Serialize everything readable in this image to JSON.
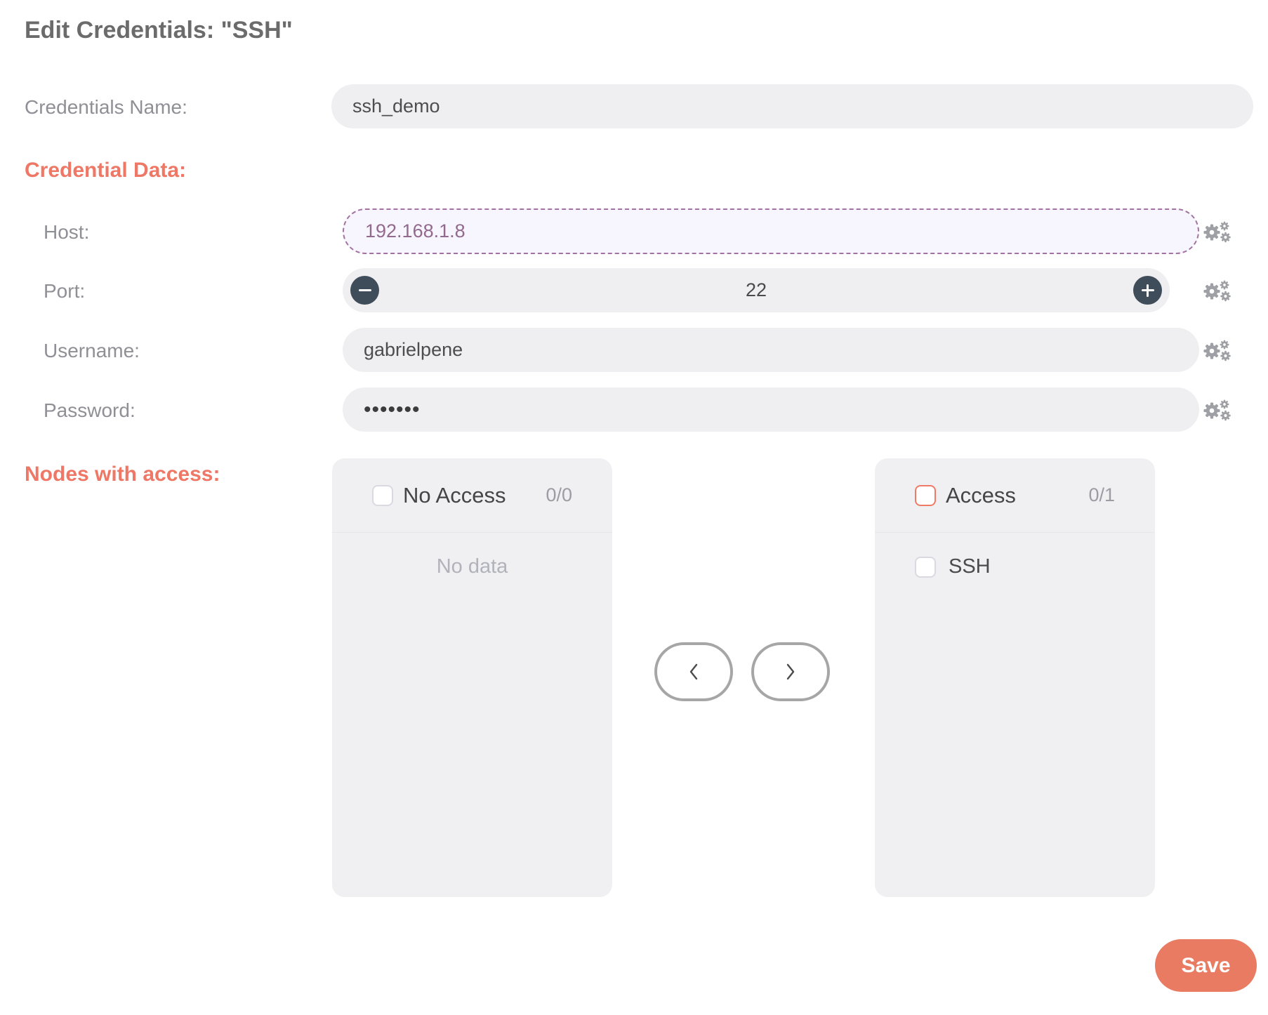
{
  "title": "Edit Credentials: \"SSH\"",
  "credentials_name": {
    "label": "Credentials Name:",
    "value": "ssh_demo"
  },
  "credential_data": {
    "heading": "Credential Data:",
    "host": {
      "label": "Host:",
      "value": "192.168.1.8"
    },
    "port": {
      "label": "Port:",
      "value": "22"
    },
    "username": {
      "label": "Username:",
      "value": "gabrielpene"
    },
    "password": {
      "label": "Password:",
      "value": "•••••••"
    }
  },
  "nodes_with_access": {
    "heading": "Nodes with access:",
    "no_access_panel": {
      "title": "No Access",
      "count": "0/0",
      "empty_text": "No data"
    },
    "access_panel": {
      "title": "Access",
      "count": "0/1",
      "items": [
        "SSH"
      ]
    }
  },
  "save_label": "Save",
  "colors": {
    "accent_heading": "#ee7765",
    "save_button": "#e97b62",
    "host_field_border": "#a472a0",
    "host_field_background": "#f7f5fd",
    "host_field_text": "#926a8e",
    "stepper_button": "#3f4c59",
    "field_background": "#efeff1",
    "panel_background": "#f0f0f2",
    "access_checkbox_border": "#ef7a66"
  }
}
